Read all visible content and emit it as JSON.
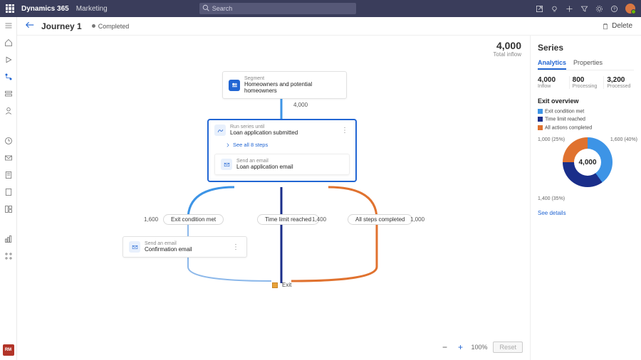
{
  "brand": {
    "app": "Dynamics 365",
    "module": "Marketing"
  },
  "search": {
    "placeholder": "Search"
  },
  "page": {
    "title": "Journey 1",
    "status": "Completed",
    "delete_label": "Delete"
  },
  "canvas": {
    "total_inflow_value": "4,000",
    "total_inflow_label": "Total inflow",
    "nodes": {
      "segment": {
        "type_label": "Segment",
        "title": "Homeowners and potential homeowners"
      },
      "segment_out_count": "4,000",
      "series": {
        "type_label": "Run series until",
        "title": "Loan application submitted",
        "see_all": "See all 8 steps",
        "inner": {
          "type_label": "Send an email",
          "title": "Loan application email"
        }
      },
      "branch_counts": {
        "left": "1,600",
        "mid": "1,400",
        "right": "1,000"
      },
      "branch_labels": {
        "left": "Exit condition met",
        "mid": "Time limit reached",
        "right": "All steps completed"
      },
      "confirm": {
        "type_label": "Send an email",
        "title": "Confirmation email"
      },
      "exit_label": "Exit"
    },
    "zoom": {
      "value": "100%",
      "reset": "Reset"
    }
  },
  "side": {
    "title": "Series",
    "tabs": {
      "analytics": "Analytics",
      "properties": "Properties"
    },
    "stats": [
      {
        "n": "4,000",
        "l": "Inflow"
      },
      {
        "n": "800",
        "l": "Processing"
      },
      {
        "n": "3,200",
        "l": "Processed"
      }
    ],
    "exit_overview_title": "Exit overview",
    "legend": {
      "ec": "Exit condition met",
      "tl": "Time limit reached",
      "ac": "All actions completed"
    },
    "donut": {
      "center": "4,000",
      "tl_note": "1,000 (25%)",
      "tr_note": "1,600 (40%)",
      "bl_note": "1,400 (35%)"
    },
    "see_details": "See details"
  },
  "chart_data": {
    "type": "pie",
    "title": "Exit overview",
    "series": [
      {
        "name": "Exit condition met",
        "value": 1600,
        "pct": 40,
        "color": "#3d94e6"
      },
      {
        "name": "Time limit reached",
        "value": 1400,
        "pct": 35,
        "color": "#1a2e8a"
      },
      {
        "name": "All actions completed",
        "value": 1000,
        "pct": 25,
        "color": "#e0722f"
      }
    ],
    "total": 4000
  }
}
